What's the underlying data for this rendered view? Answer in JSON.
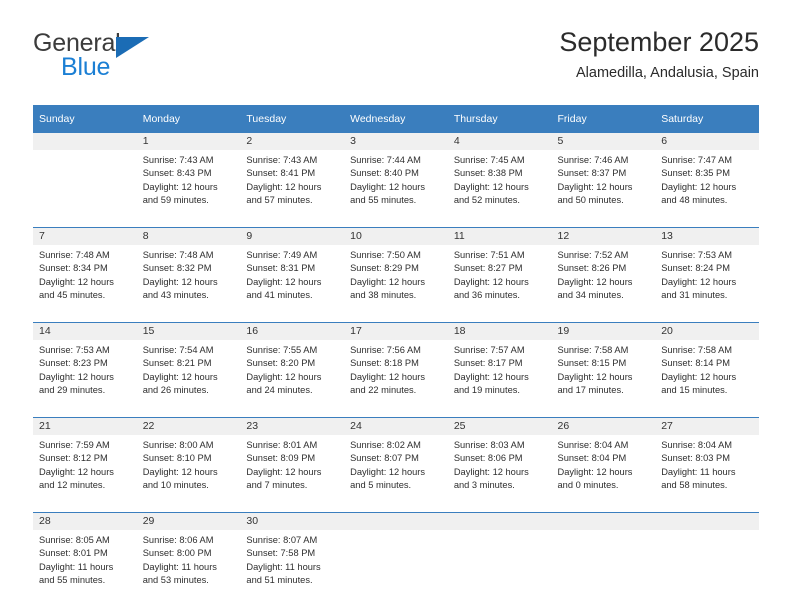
{
  "brand": {
    "line1": "General",
    "line2": "Blue",
    "triangle_color": "#1b6cb5",
    "blue_color": "#1b7fd4"
  },
  "header": {
    "title": "September 2025",
    "subtitle": "Alamedilla, Andalusia, Spain"
  },
  "theme": {
    "header_blue": "#3a7ebe",
    "daynum_band": "#f0f0f0",
    "text": "#2e2e2e"
  },
  "calendar": {
    "weekday_headers": [
      "Sunday",
      "Monday",
      "Tuesday",
      "Wednesday",
      "Thursday",
      "Friday",
      "Saturday"
    ],
    "weeks": [
      [
        {
          "day": "",
          "info": ""
        },
        {
          "day": "1",
          "info": "Sunrise: 7:43 AM\nSunset: 8:43 PM\nDaylight: 12 hours\nand 59 minutes."
        },
        {
          "day": "2",
          "info": "Sunrise: 7:43 AM\nSunset: 8:41 PM\nDaylight: 12 hours\nand 57 minutes."
        },
        {
          "day": "3",
          "info": "Sunrise: 7:44 AM\nSunset: 8:40 PM\nDaylight: 12 hours\nand 55 minutes."
        },
        {
          "day": "4",
          "info": "Sunrise: 7:45 AM\nSunset: 8:38 PM\nDaylight: 12 hours\nand 52 minutes."
        },
        {
          "day": "5",
          "info": "Sunrise: 7:46 AM\nSunset: 8:37 PM\nDaylight: 12 hours\nand 50 minutes."
        },
        {
          "day": "6",
          "info": "Sunrise: 7:47 AM\nSunset: 8:35 PM\nDaylight: 12 hours\nand 48 minutes."
        }
      ],
      [
        {
          "day": "7",
          "info": "Sunrise: 7:48 AM\nSunset: 8:34 PM\nDaylight: 12 hours\nand 45 minutes."
        },
        {
          "day": "8",
          "info": "Sunrise: 7:48 AM\nSunset: 8:32 PM\nDaylight: 12 hours\nand 43 minutes."
        },
        {
          "day": "9",
          "info": "Sunrise: 7:49 AM\nSunset: 8:31 PM\nDaylight: 12 hours\nand 41 minutes."
        },
        {
          "day": "10",
          "info": "Sunrise: 7:50 AM\nSunset: 8:29 PM\nDaylight: 12 hours\nand 38 minutes."
        },
        {
          "day": "11",
          "info": "Sunrise: 7:51 AM\nSunset: 8:27 PM\nDaylight: 12 hours\nand 36 minutes."
        },
        {
          "day": "12",
          "info": "Sunrise: 7:52 AM\nSunset: 8:26 PM\nDaylight: 12 hours\nand 34 minutes."
        },
        {
          "day": "13",
          "info": "Sunrise: 7:53 AM\nSunset: 8:24 PM\nDaylight: 12 hours\nand 31 minutes."
        }
      ],
      [
        {
          "day": "14",
          "info": "Sunrise: 7:53 AM\nSunset: 8:23 PM\nDaylight: 12 hours\nand 29 minutes."
        },
        {
          "day": "15",
          "info": "Sunrise: 7:54 AM\nSunset: 8:21 PM\nDaylight: 12 hours\nand 26 minutes."
        },
        {
          "day": "16",
          "info": "Sunrise: 7:55 AM\nSunset: 8:20 PM\nDaylight: 12 hours\nand 24 minutes."
        },
        {
          "day": "17",
          "info": "Sunrise: 7:56 AM\nSunset: 8:18 PM\nDaylight: 12 hours\nand 22 minutes."
        },
        {
          "day": "18",
          "info": "Sunrise: 7:57 AM\nSunset: 8:17 PM\nDaylight: 12 hours\nand 19 minutes."
        },
        {
          "day": "19",
          "info": "Sunrise: 7:58 AM\nSunset: 8:15 PM\nDaylight: 12 hours\nand 17 minutes."
        },
        {
          "day": "20",
          "info": "Sunrise: 7:58 AM\nSunset: 8:14 PM\nDaylight: 12 hours\nand 15 minutes."
        }
      ],
      [
        {
          "day": "21",
          "info": "Sunrise: 7:59 AM\nSunset: 8:12 PM\nDaylight: 12 hours\nand 12 minutes."
        },
        {
          "day": "22",
          "info": "Sunrise: 8:00 AM\nSunset: 8:10 PM\nDaylight: 12 hours\nand 10 minutes."
        },
        {
          "day": "23",
          "info": "Sunrise: 8:01 AM\nSunset: 8:09 PM\nDaylight: 12 hours\nand 7 minutes."
        },
        {
          "day": "24",
          "info": "Sunrise: 8:02 AM\nSunset: 8:07 PM\nDaylight: 12 hours\nand 5 minutes."
        },
        {
          "day": "25",
          "info": "Sunrise: 8:03 AM\nSunset: 8:06 PM\nDaylight: 12 hours\nand 3 minutes."
        },
        {
          "day": "26",
          "info": "Sunrise: 8:04 AM\nSunset: 8:04 PM\nDaylight: 12 hours\nand 0 minutes."
        },
        {
          "day": "27",
          "info": "Sunrise: 8:04 AM\nSunset: 8:03 PM\nDaylight: 11 hours\nand 58 minutes."
        }
      ],
      [
        {
          "day": "28",
          "info": "Sunrise: 8:05 AM\nSunset: 8:01 PM\nDaylight: 11 hours\nand 55 minutes."
        },
        {
          "day": "29",
          "info": "Sunrise: 8:06 AM\nSunset: 8:00 PM\nDaylight: 11 hours\nand 53 minutes."
        },
        {
          "day": "30",
          "info": "Sunrise: 8:07 AM\nSunset: 7:58 PM\nDaylight: 11 hours\nand 51 minutes."
        },
        {
          "day": "",
          "info": ""
        },
        {
          "day": "",
          "info": ""
        },
        {
          "day": "",
          "info": ""
        },
        {
          "day": "",
          "info": ""
        }
      ]
    ]
  }
}
